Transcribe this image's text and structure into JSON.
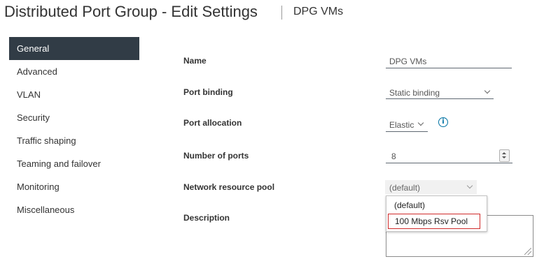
{
  "header": {
    "title": "Distributed Port Group - Edit Settings",
    "subtitle": "DPG VMs"
  },
  "sidebar": {
    "items": [
      {
        "label": "General",
        "active": true
      },
      {
        "label": "Advanced"
      },
      {
        "label": "VLAN"
      },
      {
        "label": "Security"
      },
      {
        "label": "Traffic shaping"
      },
      {
        "label": "Teaming and failover"
      },
      {
        "label": "Monitoring"
      },
      {
        "label": "Miscellaneous"
      }
    ]
  },
  "form": {
    "name": {
      "label": "Name",
      "value": "DPG VMs"
    },
    "port_binding": {
      "label": "Port binding",
      "value": "Static binding"
    },
    "port_allocation": {
      "label": "Port allocation",
      "value": "Elastic",
      "icon": "info-icon"
    },
    "num_ports": {
      "label": "Number of ports",
      "value": "8"
    },
    "resource_pool": {
      "label": "Network resource pool",
      "value": "(default)",
      "options": [
        "(default)",
        "100 Mbps Rsv Pool"
      ],
      "highlighted_option": "100 Mbps Rsv Pool"
    },
    "description": {
      "label": "Description",
      "value": ""
    }
  },
  "colors": {
    "nav_active_bg": "#313c46",
    "info_blue": "#0072a3",
    "highlight_border": "#d02a2a"
  }
}
